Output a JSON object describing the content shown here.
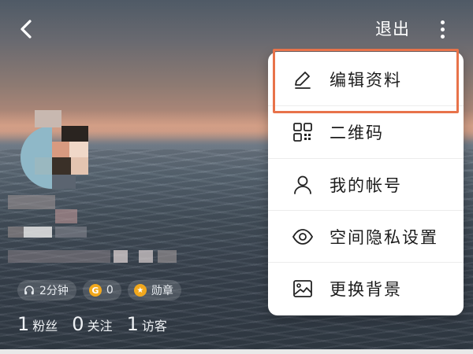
{
  "header": {
    "back_icon": "chevron-left-icon",
    "exit_label": "退出",
    "more_icon": "more-vertical-icon"
  },
  "menu": {
    "items": [
      {
        "label": "编辑资料",
        "icon": "edit-pencil-icon"
      },
      {
        "label": "二维码",
        "icon": "qr-code-icon"
      },
      {
        "label": "我的帐号",
        "icon": "user-icon"
      },
      {
        "label": "空间隐私设置",
        "icon": "eye-icon"
      },
      {
        "label": "更换背景",
        "icon": "image-icon"
      }
    ],
    "highlight_color": "#e8734a"
  },
  "badges": [
    {
      "icon": "headphones-icon",
      "text": "2分钟"
    },
    {
      "icon": "coin-icon",
      "coin_letter": "G",
      "text": "0"
    },
    {
      "icon": "medal-icon",
      "text": "勋章"
    }
  ],
  "stats": [
    {
      "num": "1",
      "label": "粉丝"
    },
    {
      "num": "0",
      "label": "关注"
    },
    {
      "num": "1",
      "label": "访客"
    }
  ],
  "colors": {
    "accent": "#f2a81d",
    "menu_bg": "#ffffff",
    "menu_text": "#1b1b1b"
  }
}
